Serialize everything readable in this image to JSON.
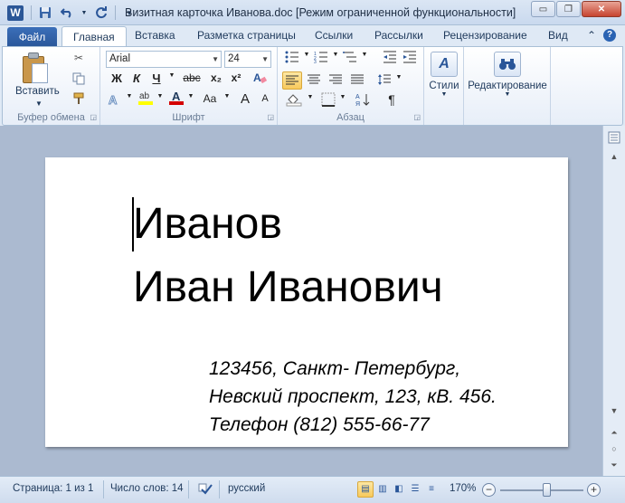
{
  "app": {
    "logo": "W",
    "title": "Визитная карточка Иванова.doc [Режим ограниченной функциональности]"
  },
  "window_controls": {
    "minimize": "▭",
    "maximize": "❐",
    "close": "✕"
  },
  "tabs": {
    "file": "Файл",
    "items": [
      "Главная",
      "Вставка",
      "Разметка страницы",
      "Ссылки",
      "Рассылки",
      "Рецензирование",
      "Вид"
    ],
    "active": "Главная"
  },
  "ribbon": {
    "clipboard": {
      "paste_label": "Вставить",
      "group_label": "Буфер обмена"
    },
    "font": {
      "font_name": "Arial",
      "font_size": "24",
      "bold": "Ж",
      "italic": "К",
      "underline": "Ч",
      "strike": "abc",
      "subscript": "x₂",
      "superscript": "x²",
      "change_case": "Aa",
      "grow": "A",
      "shrink": "A",
      "group_label": "Шрифт"
    },
    "paragraph": {
      "group_label": "Абзац",
      "pilcrow": "¶"
    },
    "styles": {
      "label": "Стили",
      "icon_letter": "A"
    },
    "editing": {
      "label": "Редактирование"
    }
  },
  "document": {
    "line1": "Иванов",
    "line2": "Иван Иванович",
    "address": [
      "123456, Санкт- Петербург,",
      "Невский проспект, 123, кВ. 456.",
      "Телефон (812) 555-66-77"
    ]
  },
  "statusbar": {
    "page": "Страница: 1 из 1",
    "words": "Число слов: 14",
    "language": "русский",
    "zoom": "170%"
  },
  "colors": {
    "accent": "#2a5699",
    "highlight": "#f8c95c",
    "text_highlight_yellow": "#ffff00",
    "font_color_red": "#d40000"
  }
}
